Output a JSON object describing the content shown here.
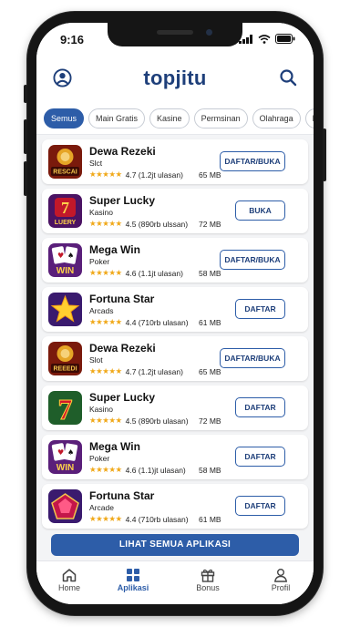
{
  "status": {
    "time": "9:16"
  },
  "header": {
    "brand": "topjitu"
  },
  "chips": [
    "Semus",
    "Main Gratis",
    "Kasine",
    "Permsinan",
    "Olahraga",
    "Laimy"
  ],
  "apps": [
    {
      "name": "Dewa Rezeki",
      "category": "Slct",
      "rating": "4.7 (1.2jt ulasan)",
      "size": "65 MB",
      "action": "DAFTAR/BUKA",
      "icon_text": "RESCAI",
      "icon": "dewa-rezeki-icon"
    },
    {
      "name": "Super Lucky",
      "category": "Kasino",
      "rating": "4.5 (890rb ulssan)",
      "size": "72 MB",
      "action": "BUKA",
      "icon_text": "LUERY",
      "icon": "super-lucky-icon"
    },
    {
      "name": "Mega Win",
      "category": "Poker",
      "rating": "4.6 (1.1jt ulasan)",
      "size": "58 MB",
      "action": "DAFTAR/BUKA",
      "icon_text": "WIN",
      "icon": "mega-win-icon"
    },
    {
      "name": "Fortuna Star",
      "category": "Arcads",
      "rating": "4.4 (710rb ulasan)",
      "size": "61 MB",
      "action": "DAFTAR",
      "icon_text": "",
      "icon": "fortuna-star-icon"
    },
    {
      "name": "Dewa Rezeki",
      "category": "Slot",
      "rating": "4.7 (1.2jt ulasan)",
      "size": "65 MB",
      "action": "DAFTAR/BUKA",
      "icon_text": "REEEDI",
      "icon": "dewa-rezeki-icon"
    },
    {
      "name": "Super Lucky",
      "category": "Kasino",
      "rating": "4.5 (890rb ulasan)",
      "size": "72 MB",
      "action": "DAFTAR",
      "icon_text": "",
      "icon": "super-lucky-icon"
    },
    {
      "name": "Mega Win",
      "category": "Poker",
      "rating": "4.6 (1.1)jt ulasan)",
      "size": "58 MB",
      "action": "DAFTAR",
      "icon_text": "WIN",
      "icon": "mega-win-icon"
    },
    {
      "name": "Fortuna Star",
      "category": "Arcade",
      "rating": "4.4 (710rb ulasan)",
      "size": "61 MB",
      "action": "DAFTAR",
      "icon_text": "",
      "icon": "fortuna-star-icon"
    }
  ],
  "see_all": "LIHAT SEMUA APLIKASI",
  "tabs": [
    {
      "label": "Home",
      "icon": "home-icon"
    },
    {
      "label": "Aplikasi",
      "icon": "grid-icon"
    },
    {
      "label": "Bonus",
      "icon": "gift-icon"
    },
    {
      "label": "Profil",
      "icon": "user-icon"
    }
  ],
  "colors": {
    "brand": "#1e3f7a",
    "accent": "#2d5da8",
    "star": "#f0a818"
  }
}
